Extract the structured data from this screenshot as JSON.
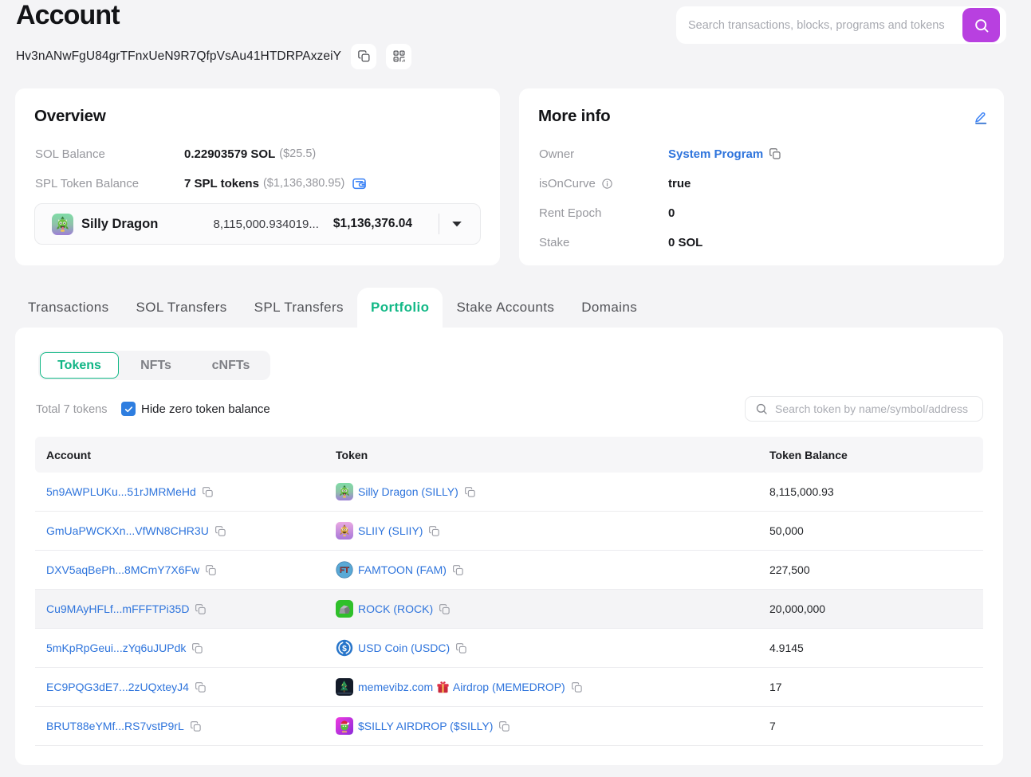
{
  "page": {
    "title": "Account",
    "address": "Hv3nANwFgU84grTFnxUeN9R7QfpVsAu41HTDRPAxzeiY"
  },
  "top_search": {
    "placeholder": "Search transactions, blocks, programs and tokens"
  },
  "overview": {
    "title": "Overview",
    "sol_balance": {
      "label": "SOL Balance",
      "value": "0.22903579 SOL",
      "usd": "($25.5)"
    },
    "spl_balance": {
      "label": "SPL Token Balance",
      "value": "7 SPL tokens",
      "usd": "($1,136,380.95)"
    },
    "token_selector": {
      "name": "Silly Dragon",
      "icon": "silly",
      "amount": "8,115,000.934019...",
      "usd": "$1,136,376.04"
    }
  },
  "more_info": {
    "title": "More info",
    "rows": [
      {
        "label": "Owner",
        "value": "System Program",
        "type": "link-copy"
      },
      {
        "label": "isOnCurve",
        "value": "true",
        "type": "info"
      },
      {
        "label": "Rent Epoch",
        "value": "0",
        "type": "plain"
      },
      {
        "label": "Stake",
        "value": "0 SOL",
        "type": "plain"
      }
    ]
  },
  "tabs": [
    {
      "label": "Transactions",
      "active": false
    },
    {
      "label": "SOL Transfers",
      "active": false
    },
    {
      "label": "SPL Transfers",
      "active": false
    },
    {
      "label": "Portfolio",
      "active": true
    },
    {
      "label": "Stake Accounts",
      "active": false
    },
    {
      "label": "Domains",
      "active": false
    }
  ],
  "portfolio": {
    "subtabs": [
      {
        "label": "Tokens",
        "active": true
      },
      {
        "label": "NFTs",
        "active": false
      },
      {
        "label": "cNFTs",
        "active": false
      }
    ],
    "total_text": "Total 7 tokens",
    "hide_zero_label": "Hide zero token balance",
    "hide_zero_checked": true,
    "search_placeholder": "Search token by name/symbol/address",
    "table": {
      "headers": [
        "Account",
        "Token",
        "Token Balance"
      ],
      "rows": [
        {
          "account": "5n9AWPLUKu...51rJMRMeHd",
          "token": "Silly Dragon (SILLY)",
          "icon": "silly",
          "balance": "8,115,000.93",
          "highlight": false
        },
        {
          "account": "GmUaPWCKXn...VfWN8CHR3U",
          "token": "SLIIY (SLIIY)",
          "icon": "sliiy",
          "balance": "50,000",
          "highlight": false
        },
        {
          "account": "DXV5aqBePh...8MCmY7X6Fw",
          "token": "FAMTOON (FAM)",
          "icon": "famtoon",
          "balance": "227,500",
          "highlight": false
        },
        {
          "account": "Cu9MAyHFLf...mFFFTPi35D",
          "token": "ROCK (ROCK)",
          "icon": "rock",
          "balance": "20,000,000",
          "highlight": true
        },
        {
          "account": "5mKpRpGeui...zYq6uJUPdk",
          "token": "USD Coin (USDC)",
          "icon": "usdc",
          "balance": "4.9145",
          "highlight": false
        },
        {
          "account": "EC9PQG3dE7...2zUQxteyJ4",
          "token": "memevibz.com 🎁 Airdrop (MEMEDROP)",
          "icon": "memedrop",
          "balance": "17",
          "highlight": false
        },
        {
          "account": "BRUT88eYMf...RS7vstP9rL",
          "token": "$SILLY AIRDROP ($SILLY)",
          "icon": "ssilly",
          "balance": "7",
          "highlight": false
        }
      ]
    }
  },
  "colors": {
    "accent_green": "#12b886",
    "accent_purple": "#b840e0",
    "link_blue": "#2e74dc",
    "checkbox_blue": "#2e7ee0",
    "icon_blue": "#3b82f6"
  }
}
